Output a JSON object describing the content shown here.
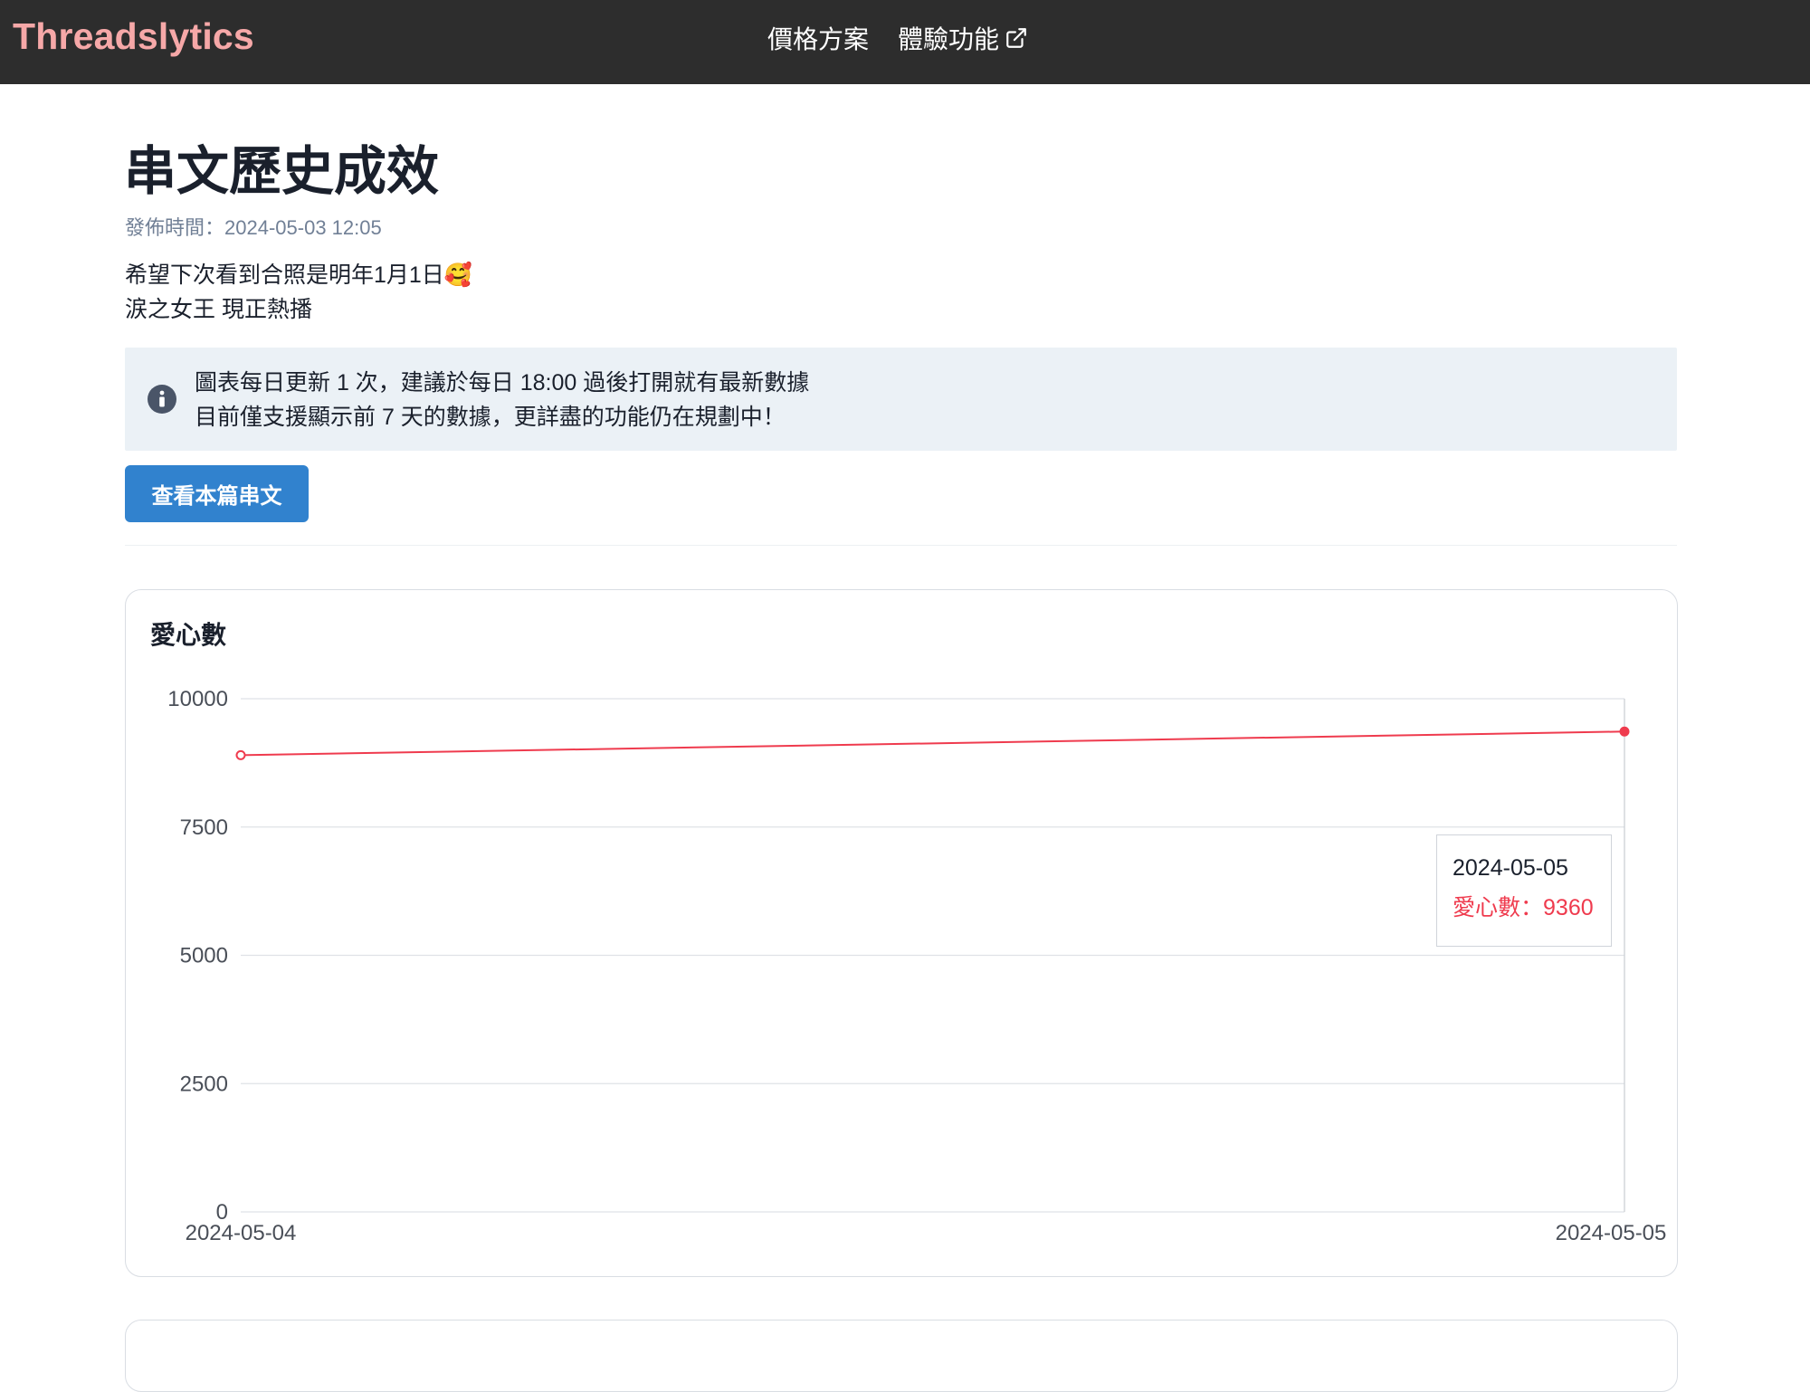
{
  "navbar": {
    "brand": "Threadslytics",
    "links": [
      {
        "label": "價格方案",
        "icon": null
      },
      {
        "label": "體驗功能",
        "icon": "external-link-icon"
      }
    ]
  },
  "post": {
    "title": "串文歷史成效",
    "publish_label": "發佈時間：",
    "publish_time": "2024-05-03 12:05",
    "body_lines": [
      "希望下次看到合照是明年1月1日🥰",
      "涙之女王 現正熱播"
    ]
  },
  "notice": {
    "icon": "info-icon",
    "lines": [
      "圖表每日更新 1 次，建議於每日 18:00 過後打開就有最新數據",
      "目前僅支援顯示前 7 天的數據，更詳盡的功能仍在規劃中！"
    ]
  },
  "view_button": {
    "label": "查看本篇串文"
  },
  "colors": {
    "brand": "#f6a8a8",
    "navbar_bg": "#2d2d2d",
    "button": "#3182ce",
    "series": "#ef3b4e",
    "notice_bg": "#ebf1f6"
  },
  "chart_data": {
    "type": "line",
    "title": "愛心數",
    "x": [
      "2024-05-04",
      "2024-05-05"
    ],
    "series": [
      {
        "name": "愛心數",
        "values": [
          8900,
          9360
        ],
        "color": "#ef3b4e"
      }
    ],
    "ylim": [
      0,
      10000
    ],
    "yticks": [
      0,
      2500,
      5000,
      7500,
      10000
    ],
    "grid": true,
    "tooltip": {
      "date": "2024-05-05",
      "label": "愛心數",
      "separator": "：",
      "value": "9360"
    }
  }
}
